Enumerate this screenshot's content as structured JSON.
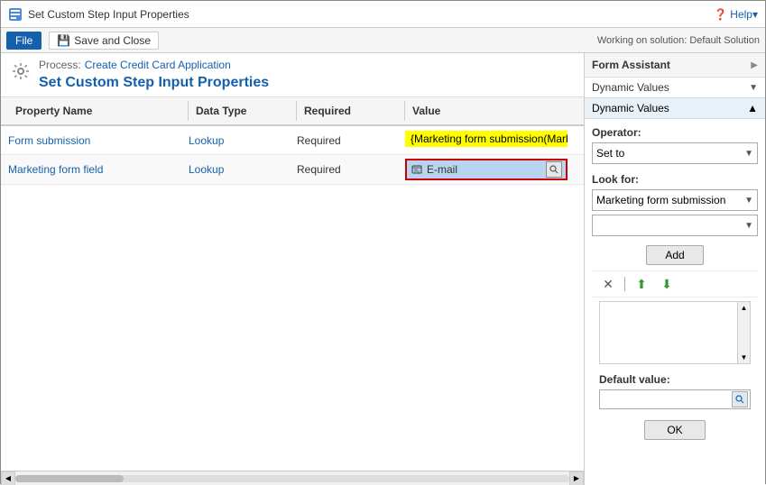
{
  "titlebar": {
    "icon": "⚙",
    "title": "Set Custom Step Input Properties",
    "save_close_label": "Save and Close",
    "help_label": "Help"
  },
  "toolbar": {
    "file_label": "File"
  },
  "working_on": {
    "label": "Working on solution: Default Solution"
  },
  "breadcrumb": {
    "process_label": "Process:",
    "link_label": "Create Credit Card Application"
  },
  "page_title": "Set Custom Step Input Properties",
  "table": {
    "headers": [
      "Property Name",
      "Data Type",
      "Required",
      "Value"
    ],
    "rows": [
      {
        "name": "Form submission",
        "data_type": "Lookup",
        "required": "Required",
        "value": "{Marketing form submission(Mark"
      },
      {
        "name": "Marketing form field",
        "data_type": "Lookup",
        "required": "Required",
        "value": "E-mail"
      }
    ]
  },
  "right_panel": {
    "title": "Form Assistant",
    "expand_icon": "▶",
    "dynamic_values_label": "Dynamic Values",
    "dynamic_values_chevron_down": "▼",
    "dynamic_values_section_label": "Dynamic Values",
    "dynamic_values_collapse": "▲",
    "operator_label": "Operator:",
    "operator_value": "Set to",
    "operator_placeholder": "Set to",
    "look_for_label": "Look for:",
    "look_for_value": "Marketing form submission",
    "second_dropdown_value": "",
    "add_button_label": "Add",
    "default_value_label": "Default value:",
    "ok_button_label": "OK"
  },
  "scrollbar": {
    "left_arrow": "◀",
    "right_arrow": "▶"
  }
}
